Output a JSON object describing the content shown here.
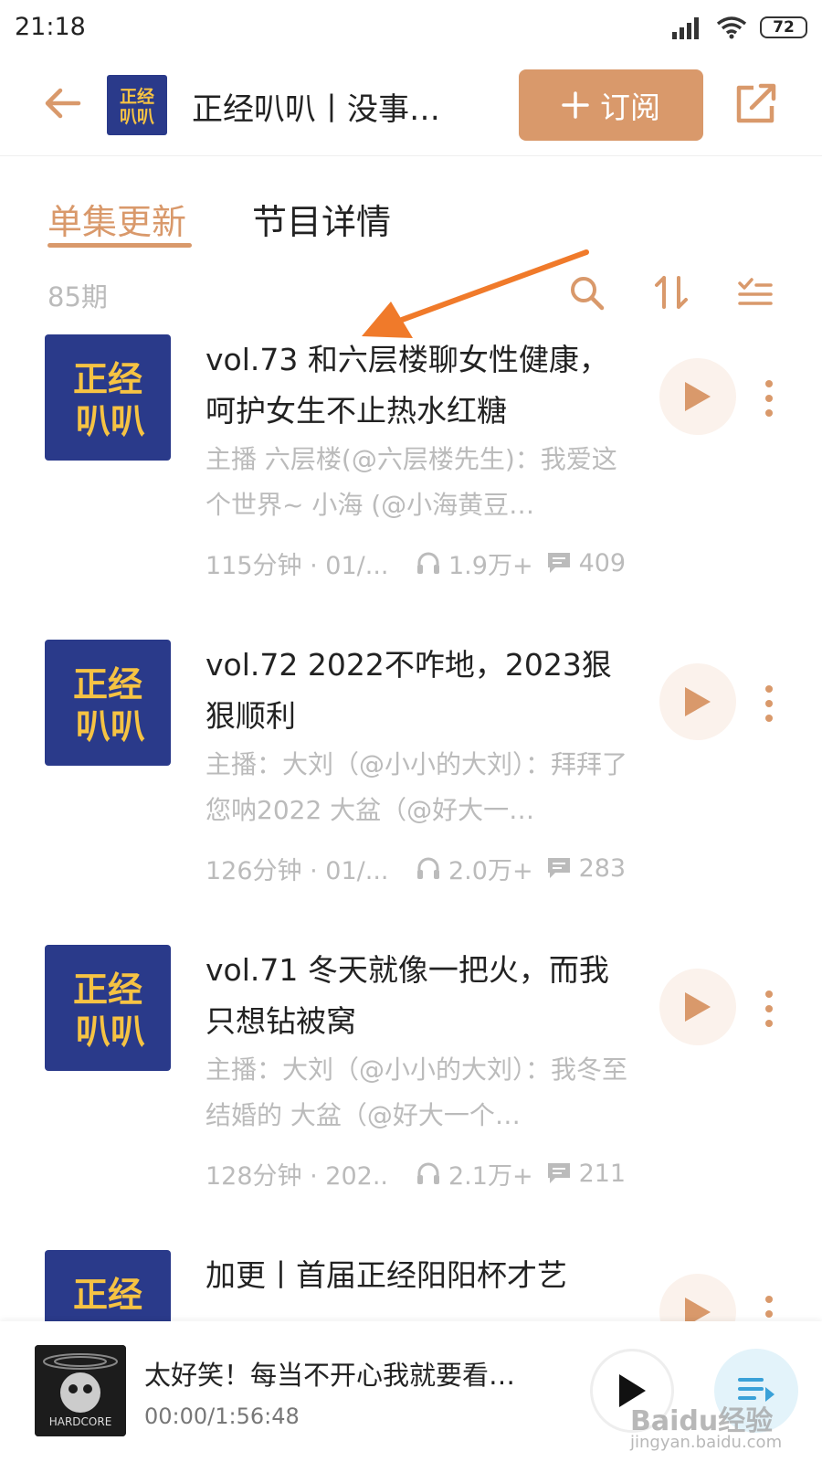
{
  "status_bar": {
    "time": "21:18",
    "battery": "72"
  },
  "header": {
    "title": "正经叭叭丨没事…",
    "subscribe_label": "订阅",
    "logo_text_1": "正经",
    "logo_text_2": "叭叭"
  },
  "tabs": [
    {
      "label": "单集更新",
      "active": true
    },
    {
      "label": "节目详情",
      "active": false
    }
  ],
  "episode_count": "85期",
  "episodes": [
    {
      "title": "vol.73 和六层楼聊女性健康，呵护女生不止热水红糖",
      "description": "主播 六层楼(@六层楼先生)：我爱这个世界~ 小海 (@小海黄豆…",
      "duration_date": "115分钟 · 01/...",
      "plays": "1.9万+",
      "comments": "409"
    },
    {
      "title": "vol.72 2022不咋地，2023狠狠顺利",
      "description": "主播：大刘（@小小的大刘）：拜拜了您呐2022 大盆（@好大一…",
      "duration_date": "126分钟 · 01/...",
      "plays": "2.0万+",
      "comments": "283"
    },
    {
      "title": "vol.71 冬天就像一把火，而我只想钻被窝",
      "description": "主播：大刘（@小小的大刘）：我冬至结婚的 大盆（@好大一个…",
      "duration_date": "128分钟 · 202...",
      "plays": "2.1万+",
      "comments": "211"
    },
    {
      "title": "加更丨首届正经阳阳杯才艺",
      "description": "",
      "duration_date": "",
      "plays": "",
      "comments": ""
    }
  ],
  "mini_player": {
    "title": "太好笑！每当不开心我就要看…",
    "time": "00:00/1:56:48",
    "cover_text": "HARDCORE"
  },
  "watermark": {
    "text": "Baidu经验",
    "sub": "jingyan.baidu.com"
  },
  "colors": {
    "accent": "#d9996b",
    "cover_bg": "#2a3a8a",
    "cover_text": "#f6c343"
  }
}
